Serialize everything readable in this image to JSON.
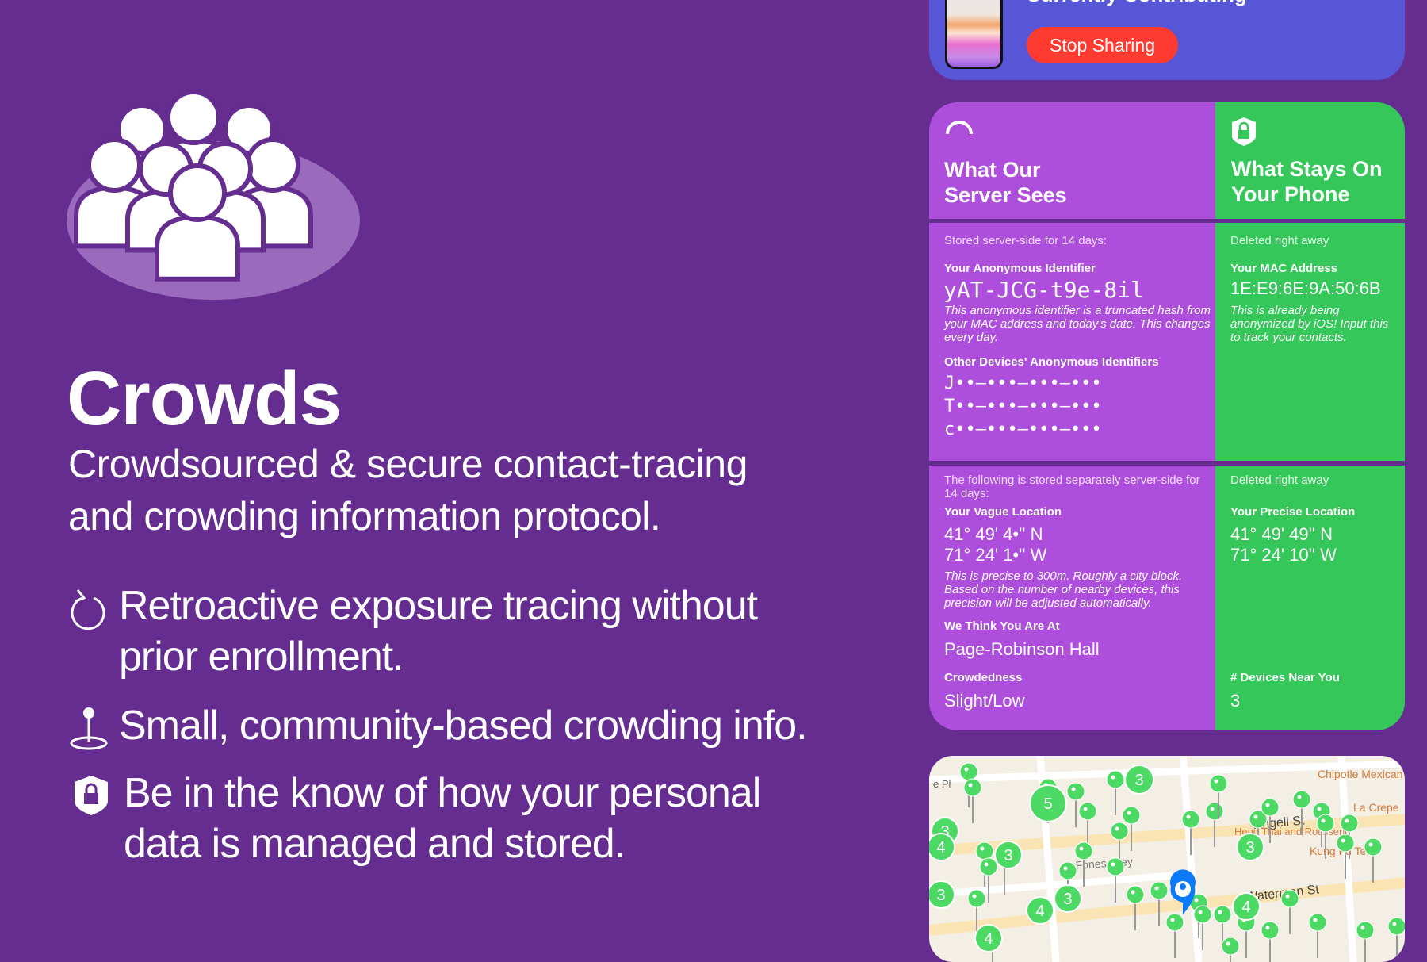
{
  "app": {
    "title": "Crowds",
    "subtitle": "Crowdsourced & secure contact-tracing and crowding information protocol.",
    "features": [
      {
        "icon": "retroactive-arrow-icon",
        "text": "Retroactive exposure tracing without prior enrollment."
      },
      {
        "icon": "location-pin-icon",
        "text": "Small, community-based crowding info."
      },
      {
        "icon": "shield-lock-icon",
        "text": "Be in the know of how your personal data is managed and stored."
      }
    ]
  },
  "colors": {
    "background": "#652d90",
    "server": "#ad4fdc",
    "phone": "#35c759",
    "status_card": "#5656d6",
    "stop": "#fd3b30"
  },
  "status": {
    "title": "Currently Contributing",
    "stop_label": "Stop Sharing"
  },
  "server": {
    "icon": "spinner-arc-icon",
    "title_line1": "What Our",
    "title_line2": "Server Sees",
    "identity": {
      "note": "Stored server-side for 14 days:",
      "label": "Your Anonymous Identifier",
      "value": "yAT-JCG-t9e-8il",
      "description": "This anonymous identifier is a truncated hash from your MAC address and today's date. This changes every day.",
      "others_label": "Other Devices' Anonymous Identifiers",
      "others": [
        "J••–•••–•••–•••",
        "T••–•••–•••–•••",
        "c••–•••–•••–•••"
      ]
    },
    "location": {
      "note": "The following is stored separately server-side for 14 days:",
      "label": "Your Vague Location",
      "lat": "41° 49' 4•'' N",
      "lon": "71° 24' 1•'' W",
      "description": "This is precise to 300m. Roughly a city block. Based on the number of nearby devices, this precision will be adjusted automatically.",
      "place_label": "We Think You Are At",
      "place": "Page-Robinson Hall",
      "crowd_label": "Crowdedness",
      "crowd": "Slight/Low"
    }
  },
  "phone": {
    "icon": "shield-lock-icon",
    "title_line1": "What Stays On",
    "title_line2": "Your Phone",
    "identity": {
      "note": "Deleted right away",
      "label": "Your MAC Address",
      "value": "1E:E9:6E:9A:50:6B",
      "description": "This is already being anonymized by iOS! Input this to track your contacts."
    },
    "location": {
      "note": "Deleted right away",
      "label": "Your Precise Location",
      "lat": "41° 49' 49'' N",
      "lon": "71° 24' 10'' W",
      "devices_label": "# Devices Near You",
      "devices": "3"
    }
  },
  "map": {
    "streets": [
      "Angell St",
      "Waterman St",
      "Fones Alley",
      "e Pl"
    ],
    "places": [
      "Chipotle Mexican Grill",
      "La Crepe",
      "Heng Thai and Rotisserie",
      "Kung Fu Tea"
    ],
    "clusters": [
      "5",
      "3",
      "3",
      "4",
      "3",
      "3",
      "3",
      "4",
      "3",
      "4",
      "4"
    ]
  }
}
